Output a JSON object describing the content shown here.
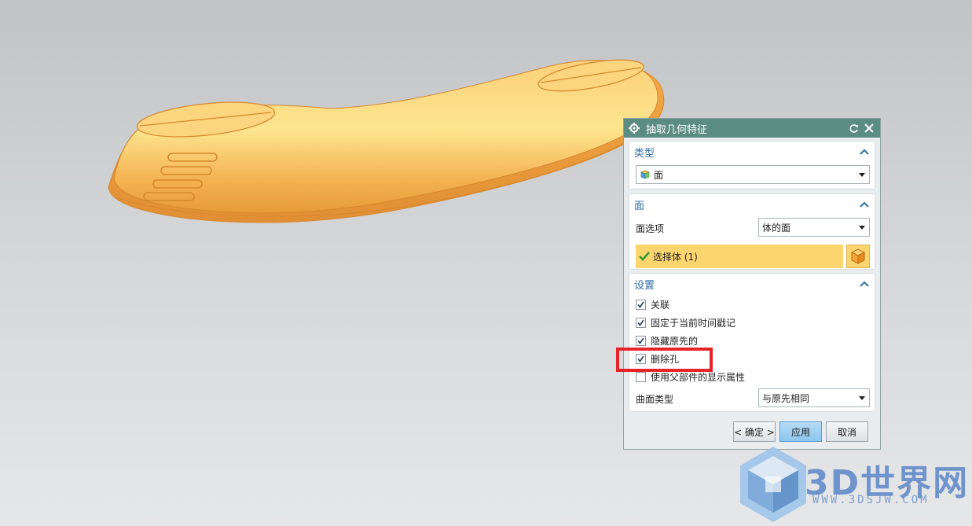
{
  "dialog": {
    "title": "抽取几何特征",
    "type_group": {
      "header": "类型",
      "selected": "面"
    },
    "face_group": {
      "header": "面",
      "face_option_label": "面选项",
      "face_option_value": "体的面",
      "select_body_label": "选择体 (1)"
    },
    "settings_group": {
      "header": "设置",
      "checkboxes": [
        {
          "label": "关联",
          "checked": true
        },
        {
          "label": "固定于当前时间戳记",
          "checked": true
        },
        {
          "label": "隐藏原先的",
          "checked": true
        },
        {
          "label": "删除孔",
          "checked": true
        },
        {
          "label": "使用父部件的显示属性",
          "checked": false
        }
      ],
      "surface_type_label": "曲面类型",
      "surface_type_value": "与原先相同"
    },
    "buttons": {
      "ok": "< 确定 >",
      "apply": "应用",
      "cancel": "取消"
    }
  },
  "watermark": {
    "brand": "3D世界网",
    "url": "WWW.3DSJW.COM"
  },
  "colors": {
    "title_bar": "#5b8c82",
    "model": "#f6b95a",
    "selection": "#fcd56e",
    "highlight": "#e8242b"
  }
}
